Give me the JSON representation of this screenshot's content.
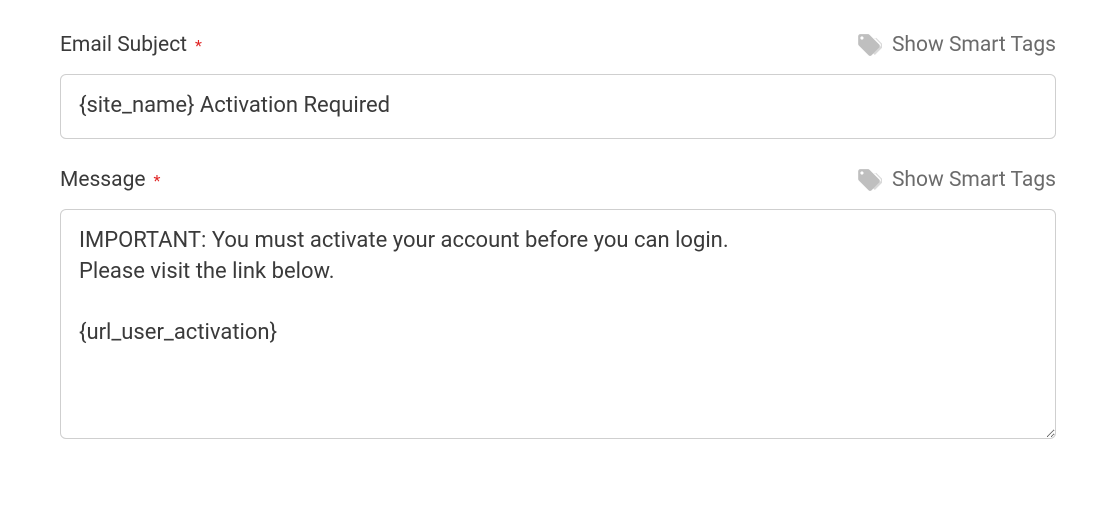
{
  "subject": {
    "label": "Email Subject",
    "value": "{site_name} Activation Required",
    "smart_tags_label": "Show Smart Tags"
  },
  "message": {
    "label": "Message",
    "value": "IMPORTANT: You must activate your account before you can login.\nPlease visit the link below.\n\n{url_user_activation}",
    "smart_tags_label": "Show Smart Tags"
  }
}
